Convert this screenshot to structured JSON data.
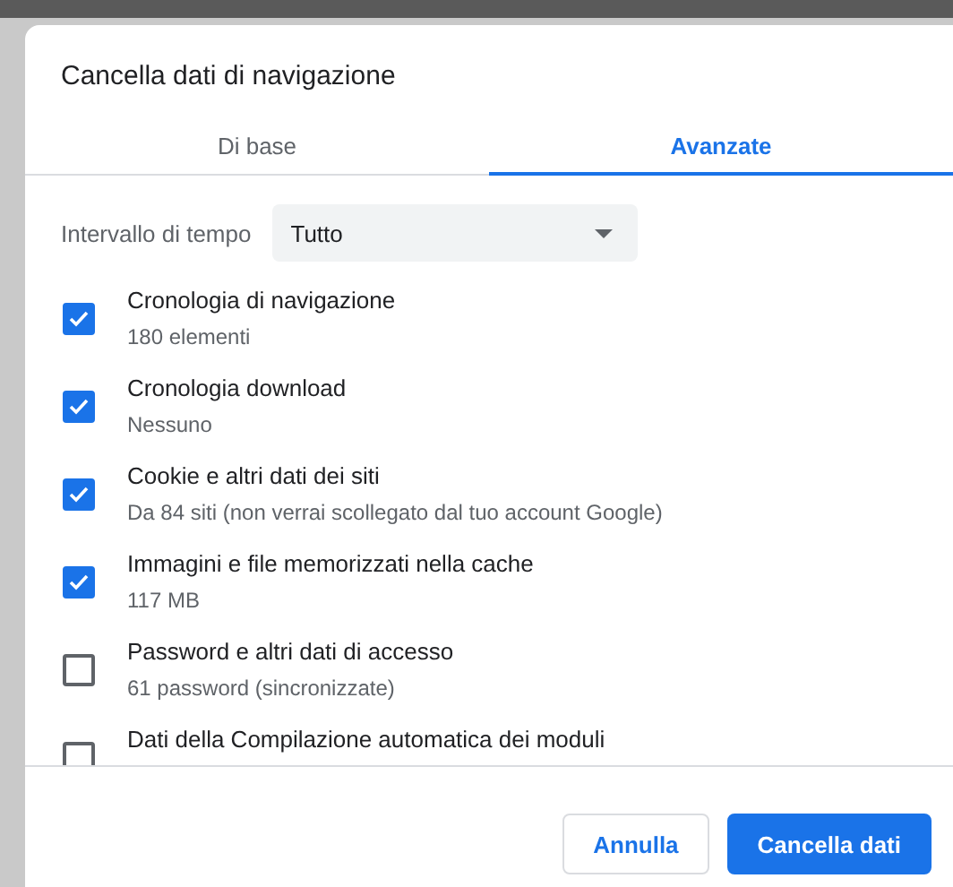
{
  "dialog": {
    "title": "Cancella dati di navigazione"
  },
  "tabs": [
    {
      "label": "Di base",
      "selected": false
    },
    {
      "label": "Avanzate",
      "selected": true
    }
  ],
  "time_range": {
    "label": "Intervallo di tempo",
    "value": "Tutto"
  },
  "items": [
    {
      "title": "Cronologia di navigazione",
      "detail": "180 elementi",
      "checked": true
    },
    {
      "title": "Cronologia download",
      "detail": "Nessuno",
      "checked": true
    },
    {
      "title": "Cookie e altri dati dei siti",
      "detail": "Da 84 siti (non verrai scollegato dal tuo account Google)",
      "checked": true
    },
    {
      "title": "Immagini e file memorizzati nella cache",
      "detail": "117 MB",
      "checked": true
    },
    {
      "title": "Password e altri dati di accesso",
      "detail": "61 password (sincronizzate)",
      "checked": false
    },
    {
      "title": "Dati della Compilazione automatica dei moduli",
      "checked": false
    }
  ],
  "buttons": [
    {
      "label": "Annulla",
      "kind": "secondary"
    },
    {
      "label": "Cancella dati",
      "kind": "primary"
    }
  ]
}
